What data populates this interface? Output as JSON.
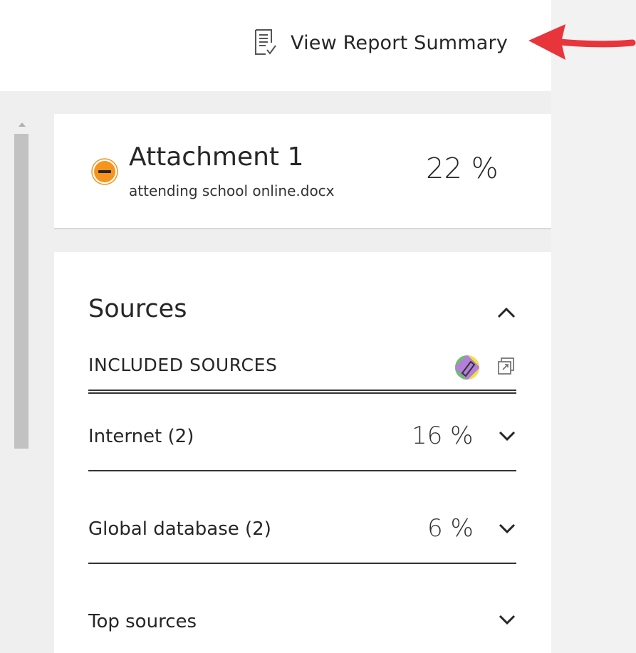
{
  "header": {
    "report_link_label": "View Report Summary",
    "report_icon": "document-check-icon"
  },
  "attachment": {
    "title": "Attachment 1",
    "filename": "attending school online.docx",
    "score": "22 %",
    "status_icon": "orange-minus-circle-icon",
    "status_color": "#f7941d"
  },
  "sources": {
    "title": "Sources",
    "collapse_icon": "chevron-up-icon",
    "included_label": "INCLUDED SOURCES",
    "filter_icon": "highlight-filter-icon",
    "export_icon": "export-icon",
    "rows": [
      {
        "label": "Internet (2)",
        "percent": "16 %"
      },
      {
        "label": "Global database (2)",
        "percent": "6 %"
      },
      {
        "label": "Top sources",
        "percent": ""
      }
    ]
  },
  "annotation": {
    "arrow_color": "#e8353b"
  }
}
